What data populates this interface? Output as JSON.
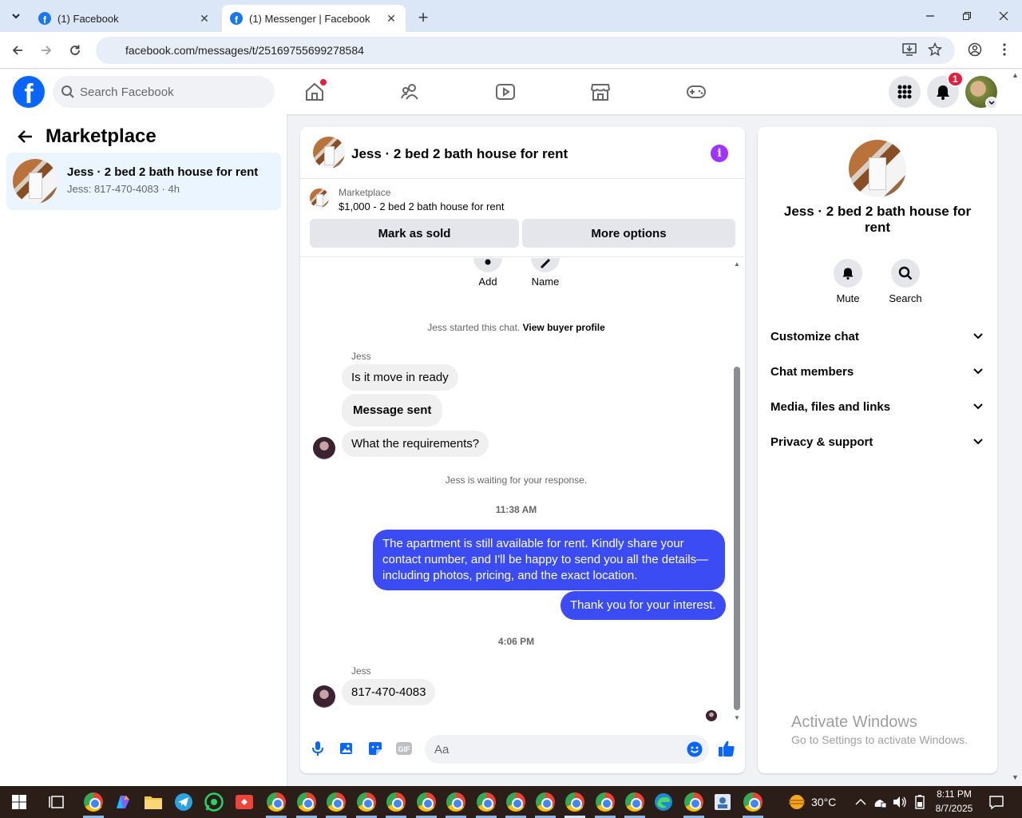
{
  "browser": {
    "tabs": [
      {
        "title": "(1) Facebook",
        "active": false
      },
      {
        "title": "(1) Messenger | Facebook",
        "active": true
      }
    ],
    "url": "facebook.com/messages/t/25169755699278584"
  },
  "header": {
    "search_placeholder": "Search Facebook",
    "notification_count": "1"
  },
  "sidebar": {
    "title": "Marketplace",
    "conversations": [
      {
        "name": "Jess · 2 bed 2 bath house for rent",
        "preview": "Jess: 817-470-4083 · 4h"
      }
    ]
  },
  "chat": {
    "title": "Jess · 2 bed 2 bath house for rent",
    "listing": {
      "label": "Marketplace",
      "price_title": "$1,000 - 2 bed 2 bath house for rent",
      "mark_sold": "Mark as sold",
      "more_options": "More options"
    },
    "actions": {
      "add": "Add",
      "name": "Name"
    },
    "started": {
      "text": "Jess started this chat.",
      "link": "View buyer profile"
    },
    "sender_name": "Jess",
    "incoming_1": [
      "Is it move in ready",
      "Message sent",
      "What the requirements?"
    ],
    "waiting": "Jess is waiting for your response.",
    "time_1": "11:38 AM",
    "outgoing": [
      "The apartment is still available for rent. Kindly share your contact number, and I'll be happy to send you all the details—including photos, pricing, and the exact location.",
      "Thank you for your interest."
    ],
    "time_2": "4:06 PM",
    "incoming_2": [
      "817-470-4083"
    ],
    "composer_placeholder": "Aa"
  },
  "info_panel": {
    "title": "Jess · 2 bed 2 bath house for rent",
    "mute": "Mute",
    "search": "Search",
    "sections": [
      "Customize chat",
      "Chat members",
      "Media, files and links",
      "Privacy & support"
    ]
  },
  "watermark": {
    "line1": "Activate Windows",
    "line2": "Go to Settings to activate Windows."
  },
  "taskbar": {
    "weather": "30°C",
    "time": "8:11 PM",
    "date": "8/7/2025"
  },
  "colors": {
    "accent": "#0866ff",
    "outgoing_bubble": "#3c4cf5",
    "badge": "#e41e3f",
    "info_icon": "#a033ff"
  }
}
